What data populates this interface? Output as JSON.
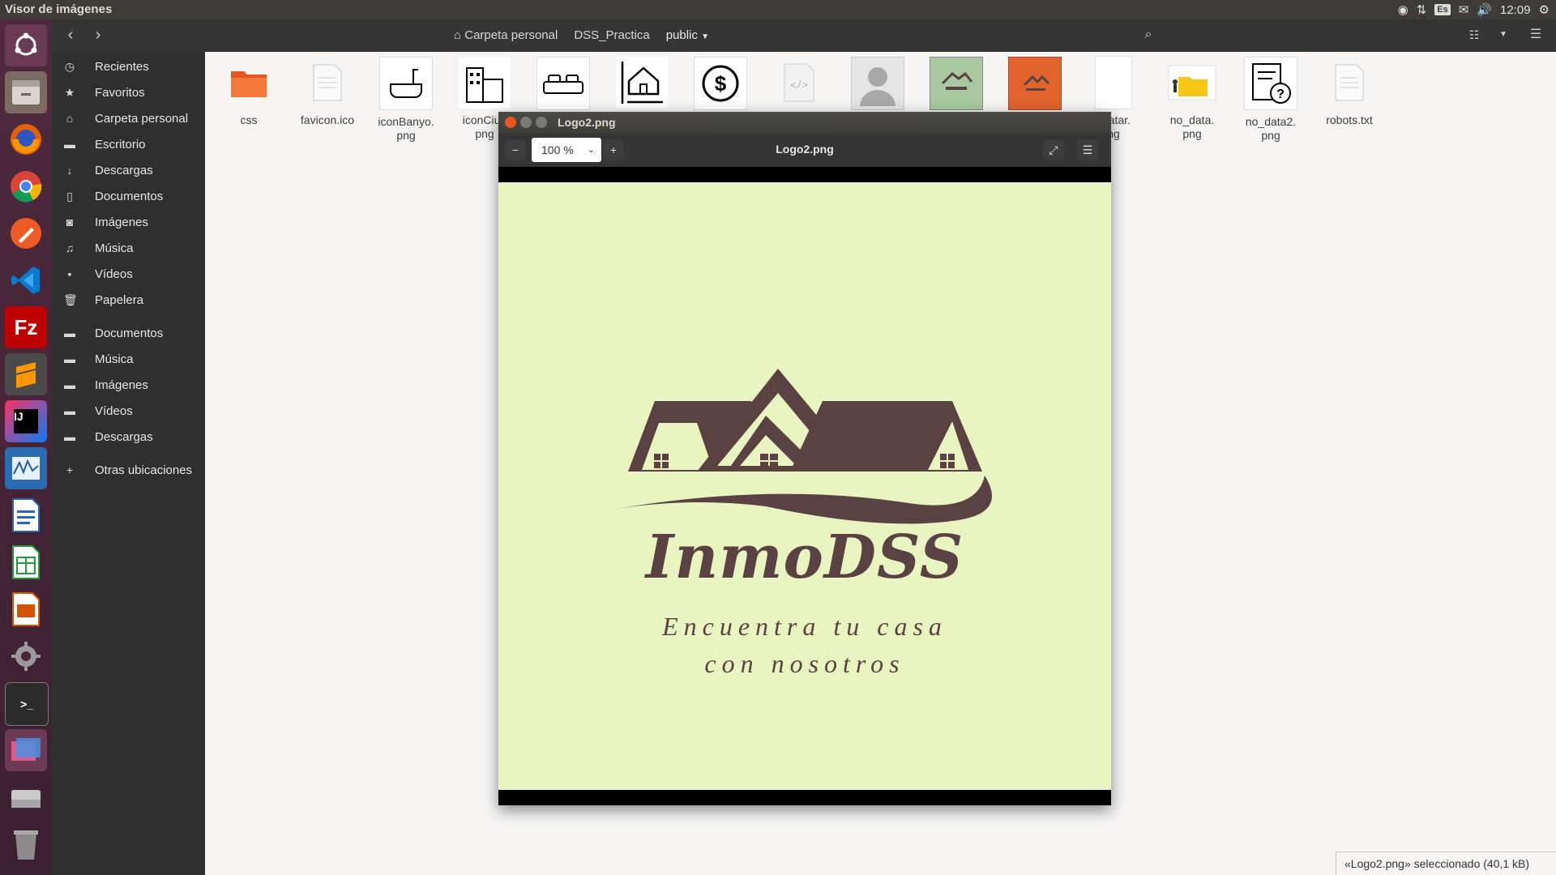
{
  "top_panel": {
    "app_title": "Visor de imágenes",
    "keyboard_layout": "Es",
    "clock": "12:09"
  },
  "file_manager": {
    "breadcrumbs": [
      "Carpeta personal",
      "DSS_Practica",
      "public"
    ],
    "sidebar": {
      "places": [
        "Recientes",
        "Favoritos",
        "Carpeta personal",
        "Escritorio",
        "Descargas",
        "Documentos",
        "Imágenes",
        "Música",
        "Vídeos",
        "Papelera"
      ],
      "bookmarks": [
        "Documentos",
        "Música",
        "Imágenes",
        "Vídeos",
        "Descargas"
      ],
      "other_locations": "Otras ubicaciones"
    },
    "files": [
      "css",
      "favicon.ico",
      "iconBanyo.\npng",
      "iconCiud\npng",
      "",
      "",
      "",
      "",
      "",
      "",
      "",
      "avatar.\nng",
      "no_data.\npng",
      "no_data2.\npng",
      "robots.txt"
    ],
    "status": "«Logo2.png» seleccionado  (40,1 kB)"
  },
  "image_viewer": {
    "window_title": "Logo2.png",
    "toolbar_title": "Logo2.png",
    "zoom": "100 %",
    "logo": {
      "brand": "InmoDSS",
      "tagline_line1": "Encuentra tu casa",
      "tagline_line2": "con nosotros",
      "background": "#e8f5c0",
      "ink": "#5b4242"
    }
  },
  "colors": {
    "launcher": "#4a2638",
    "panel": "#3c3b37",
    "accent_orange": "#e95420"
  }
}
